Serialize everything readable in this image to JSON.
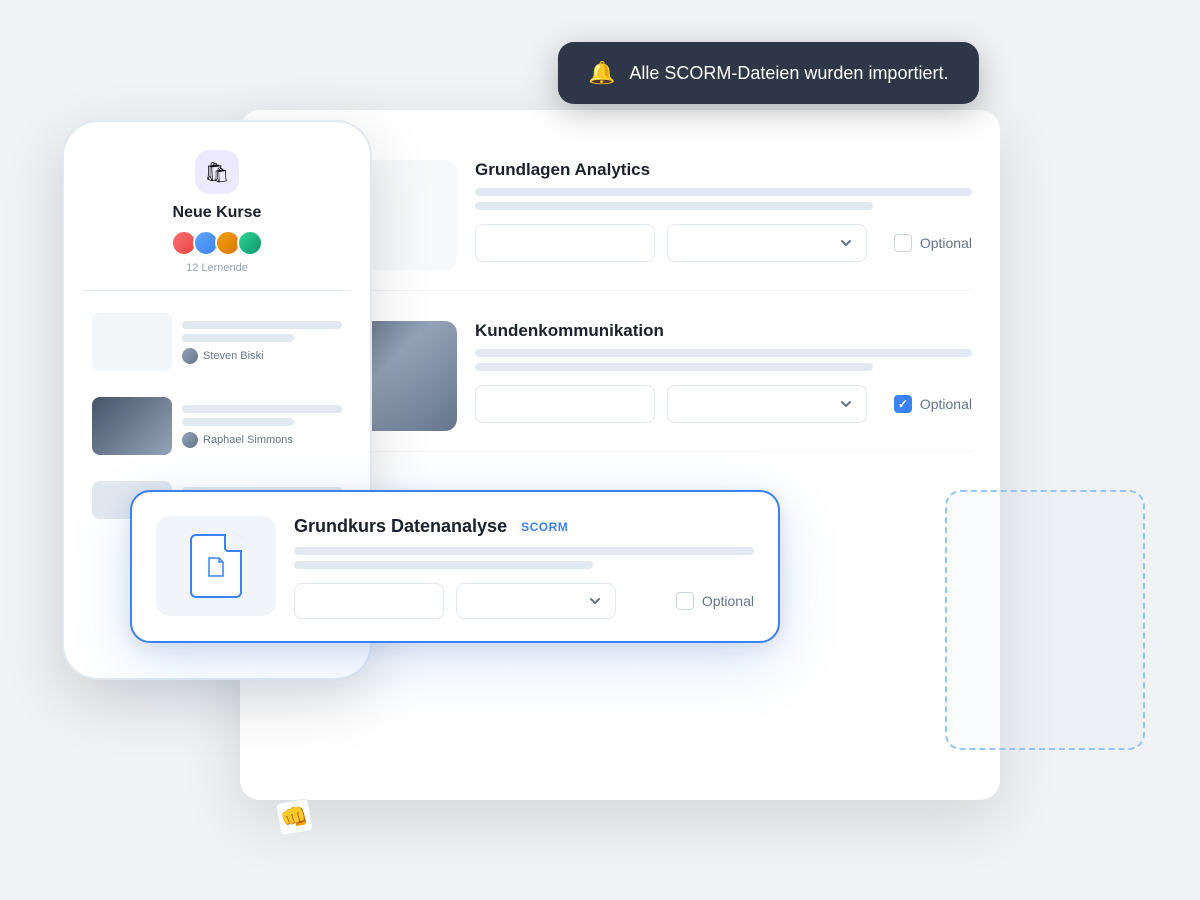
{
  "notification": {
    "icon": "🔔",
    "message": "Alle SCORM-Dateien wurden importiert."
  },
  "phone": {
    "icon": "🛍",
    "title": "Neue Kurse",
    "learner_count": "12 Lernende",
    "courses": [
      {
        "author": "Steven Biski"
      },
      {
        "author": "Raphael Simmons"
      }
    ]
  },
  "main_panel": {
    "courses": [
      {
        "title": "Grundlagen Analytics",
        "optional_label": "Optional",
        "optional_checked": false
      },
      {
        "title": "Kundenkommunikation",
        "optional_label": "Optional",
        "optional_checked": true
      }
    ]
  },
  "draggable_card": {
    "title": "Grundkurs Datenanalyse",
    "badge": "SCORM",
    "optional_label": "Optional",
    "optional_checked": false
  },
  "labels": {
    "optional": "Optional",
    "scorm": "SCORM",
    "drag_handle": "⠿",
    "chevron_down": "chevron-down"
  }
}
